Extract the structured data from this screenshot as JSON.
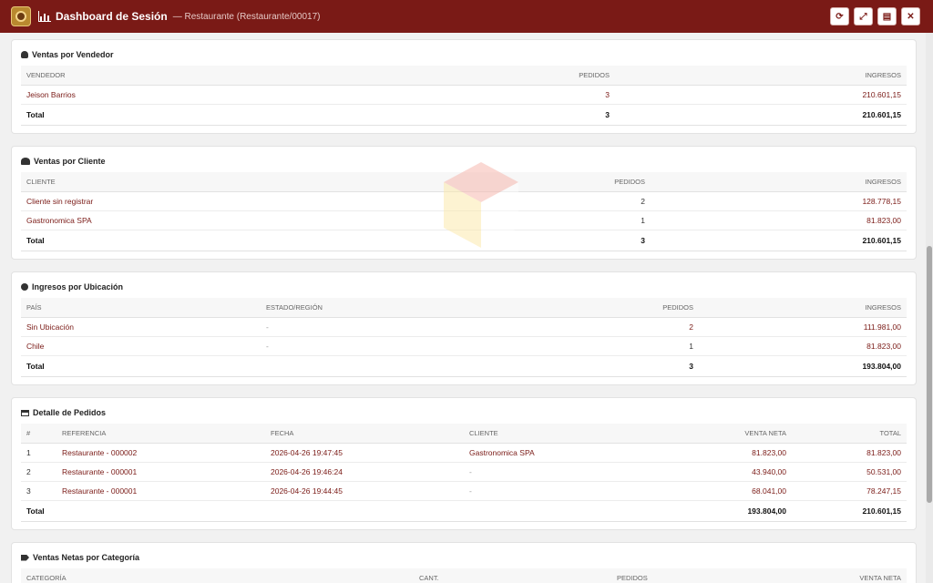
{
  "header": {
    "title": "Dashboard de Sesión",
    "subtitle": "— Restaurante (Restaurante/00017)",
    "actions": [
      {
        "name": "refresh-button",
        "icon": "refresh-icon",
        "glyph": "⟳"
      },
      {
        "name": "expand-button",
        "icon": "expand-icon",
        "glyph": "⤢"
      },
      {
        "name": "pdf-button",
        "icon": "pdf-icon",
        "glyph": "▤"
      },
      {
        "name": "close-button",
        "icon": "close-icon",
        "glyph": "✕"
      }
    ]
  },
  "vendedor": {
    "title": "Ventas por Vendedor",
    "headers": [
      "VENDEDOR",
      "PEDIDOS",
      "INGRESOS"
    ],
    "rows": [
      [
        "Jeison Barrios",
        "3",
        "210.601,15"
      ]
    ],
    "total": [
      "Total",
      "3",
      "210.601,15"
    ]
  },
  "cliente": {
    "title": "Ventas por Cliente",
    "headers": [
      "CLIENTE",
      "PEDIDOS",
      "INGRESOS"
    ],
    "rows": [
      [
        "Cliente sin registrar",
        "2",
        "128.778,15"
      ],
      [
        "Gastronomica SPA",
        "1",
        "81.823,00"
      ]
    ],
    "total": [
      "Total",
      "3",
      "210.601,15"
    ]
  },
  "ubicacion": {
    "title": "Ingresos por Ubicación",
    "headers": [
      "PAÍS",
      "ESTADO/REGIÓN",
      "PEDIDOS",
      "INGRESOS"
    ],
    "rows": [
      [
        "Sin Ubicación",
        "-",
        "2",
        "111.981,00"
      ],
      [
        "Chile",
        "-",
        "1",
        "81.823,00"
      ]
    ],
    "total": [
      "Total",
      "",
      "3",
      "193.804,00"
    ]
  },
  "pedidos": {
    "title": "Detalle de Pedidos",
    "headers": [
      "#",
      "REFERENCIA",
      "FECHA",
      "CLIENTE",
      "VENTA NETA",
      "TOTAL"
    ],
    "rows": [
      [
        "1",
        "Restaurante - 000002",
        "2026-04-26 19:47:45",
        "Gastronomica SPA",
        "81.823,00",
        "81.823,00"
      ],
      [
        "2",
        "Restaurante - 000001",
        "2026-04-26 19:46:24",
        "-",
        "43.940,00",
        "50.531,00"
      ],
      [
        "3",
        "Restaurante - 000001",
        "2026-04-26 19:44:45",
        "-",
        "68.041,00",
        "78.247,15"
      ]
    ],
    "total": [
      "Total",
      "",
      "",
      "",
      "193.804,00",
      "210.601,15"
    ]
  },
  "categoria": {
    "title": "Ventas Netas por Categoría",
    "headers": [
      "CATEGORÍA",
      "CANT.",
      "PEDIDOS",
      "VENTA NETA"
    ]
  },
  "colors": {
    "topbar": "#7a1a16",
    "link": "#7a1a16"
  }
}
